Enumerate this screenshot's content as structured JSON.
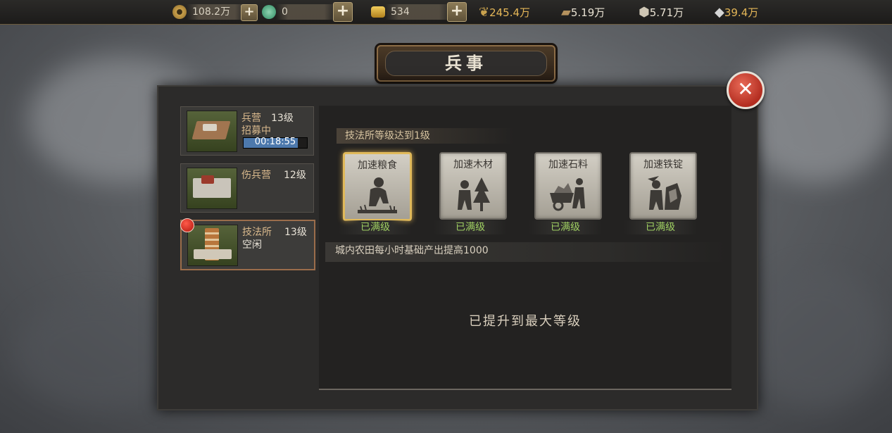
{
  "resources": {
    "copper": "108.2万",
    "jade": "0",
    "ingot": "534",
    "food": "245.4万",
    "wood": "5.19万",
    "stone": "5.71万",
    "iron": "39.4万",
    "plus_label": "+"
  },
  "title": "兵事",
  "close_label": "✕",
  "buildings": [
    {
      "name": "兵营",
      "level": "13级",
      "status": "招募中",
      "timer": "00:18:55",
      "timer_progress": 0.85
    },
    {
      "name": "伤兵营",
      "level": "12级",
      "status": ""
    },
    {
      "name": "技法所",
      "level": "13级",
      "status": "空闲"
    }
  ],
  "requirement": "技法所等级达到1级",
  "skills": [
    {
      "label": "加速粮食",
      "status": "已满级",
      "icon": "farmer-icon"
    },
    {
      "label": "加速木材",
      "status": "已满级",
      "icon": "lumberjack-icon"
    },
    {
      "label": "加速石料",
      "status": "已满级",
      "icon": "stone-cart-icon"
    },
    {
      "label": "加速铁锭",
      "status": "已满级",
      "icon": "miner-icon"
    }
  ],
  "description": "城内农田每小时基础产出提高1000",
  "max_level_text": "已提升到最大等级",
  "colors": {
    "accent_gold": "#e4b657",
    "maxed_green": "#9fcf62",
    "close_red": "#b32d20"
  }
}
